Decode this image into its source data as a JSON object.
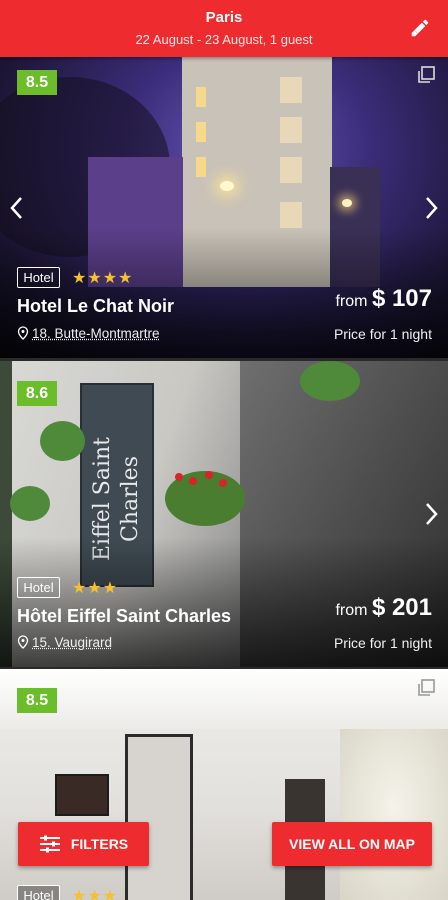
{
  "header": {
    "title": "Paris",
    "subtitle": "22 August - 23 August, 1 guest",
    "edit_icon": "pencil-icon"
  },
  "hotels": [
    {
      "score": "8.5",
      "type": "Hotel",
      "stars": "★★★★",
      "name": "Hotel Le Chat Noir",
      "location": "18. Butte-Montmartre",
      "price_prefix": "from",
      "price": "$ 107",
      "price_note": "Price for 1 night"
    },
    {
      "score": "8.6",
      "type": "Hotel",
      "stars": "★★★",
      "name": "Hôtel Eiffel Saint Charles",
      "location": "15. Vaugirard",
      "price_prefix": "from",
      "price": "$ 201",
      "price_note": "Price for 1 night"
    },
    {
      "score": "8.5",
      "type": "Hotel",
      "stars": "★★★"
    }
  ],
  "buttons": {
    "filters": "FILTERS",
    "map": "VIEW ALL ON MAP"
  },
  "signage": {
    "hotel2_sign": "Eiffel Saint Charles"
  },
  "colors": {
    "primary": "#ee2b2f",
    "score": "#6bbd2a",
    "stars": "#f7c12b"
  }
}
